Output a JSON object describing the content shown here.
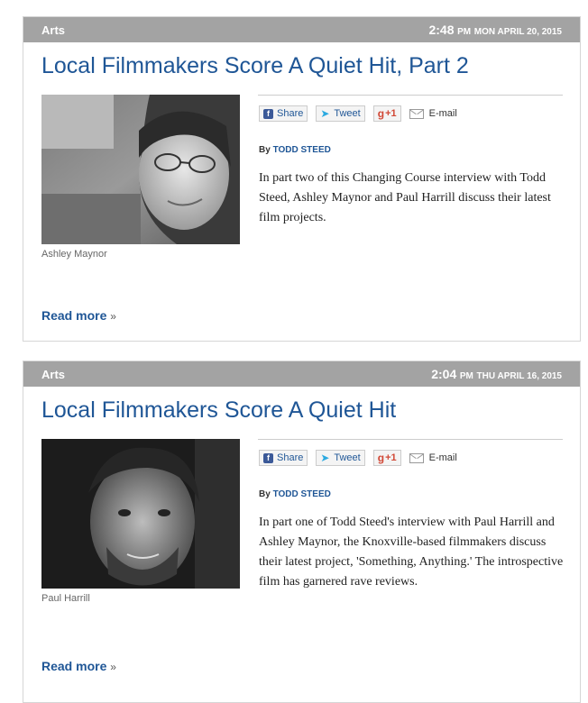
{
  "articles": [
    {
      "category": "Arts",
      "time": "2:48",
      "ampm": "PM",
      "date": "MON APRIL 20, 2015",
      "title": "Local Filmmakers Score A Quiet Hit, Part 2",
      "photo_caption": "Ashley Maynor",
      "share_label": "Share",
      "tweet_label": "Tweet",
      "gplus_label": "+1",
      "email_label": "E-mail",
      "by_label": "By",
      "author": "TODD STEED",
      "summary": "In part two of this Changing Course interview with Todd Steed, Ashley Maynor and Paul Harrill discuss their latest film projects.",
      "read_more": "Read more",
      "read_more_arrow": "»"
    },
    {
      "category": "Arts",
      "time": "2:04",
      "ampm": "PM",
      "date": "THU APRIL 16, 2015",
      "title": "Local Filmmakers Score A Quiet Hit",
      "photo_caption": "Paul Harrill",
      "share_label": "Share",
      "tweet_label": "Tweet",
      "gplus_label": "+1",
      "email_label": "E-mail",
      "by_label": "By",
      "author": "TODD STEED",
      "summary": "In part one of Todd Steed's interview with Paul Harrill and Ashley Maynor, the Knoxville-based filmmakers discuss their latest project, 'Something, Anything.'  The introspective film has garnered rave reviews.",
      "read_more": "Read more",
      "read_more_arrow": "»"
    }
  ],
  "colors": {
    "header_bar": "#a3a3a3",
    "link_blue": "#1f5696",
    "facebook": "#3b5998",
    "twitter": "#2aa9e0",
    "gplus": "#d14836"
  },
  "icons": [
    "facebook-icon",
    "twitter-bird-icon",
    "google-plus-icon",
    "envelope-icon"
  ]
}
